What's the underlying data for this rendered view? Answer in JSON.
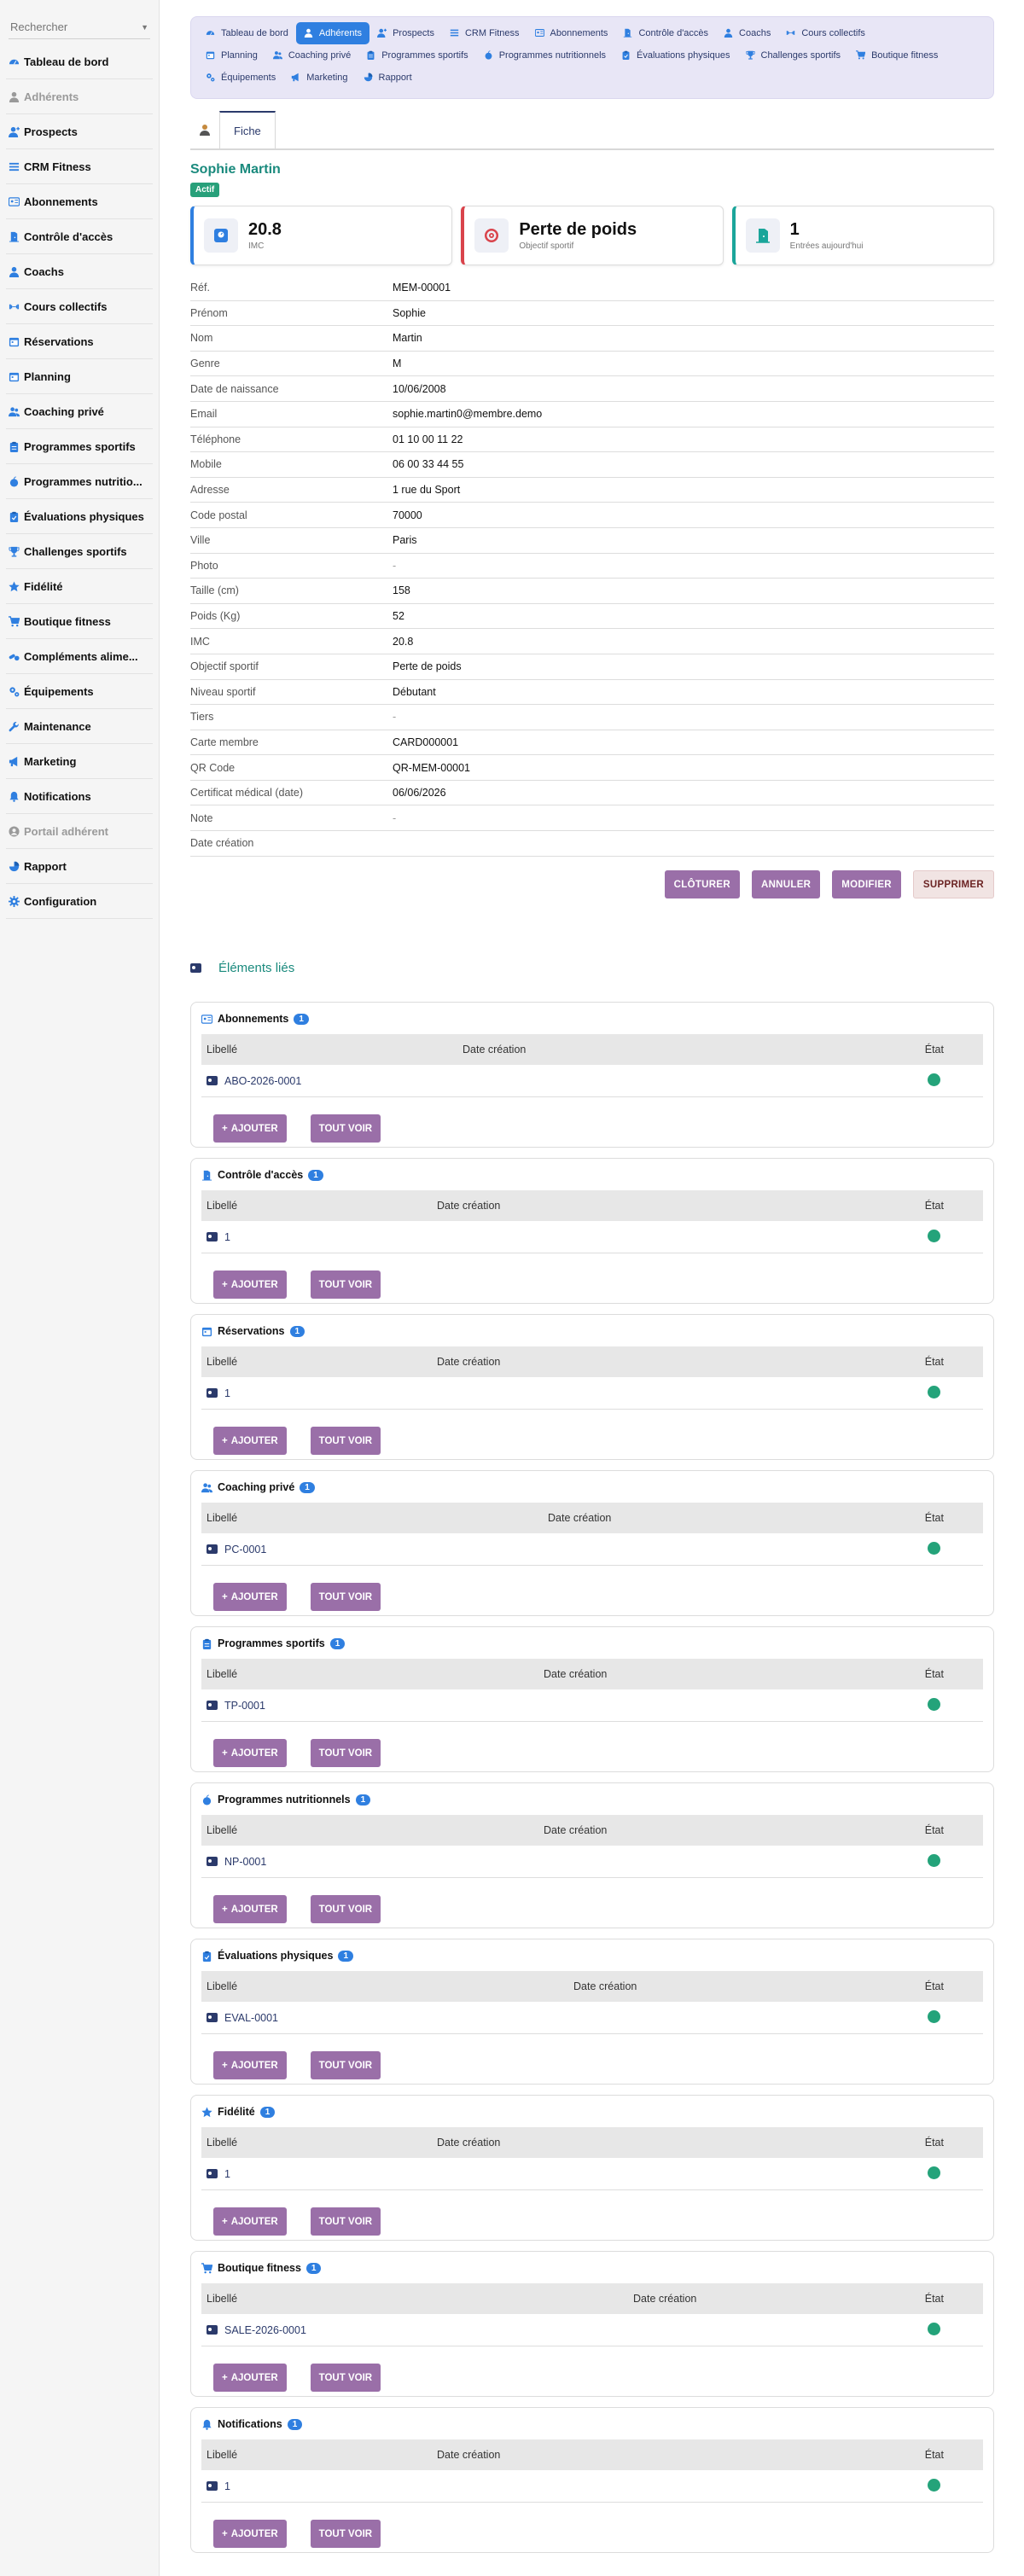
{
  "sidebar": {
    "search_placeholder": "Rechercher",
    "items": [
      {
        "label": "Tableau de bord",
        "icon": "dashboard-icon",
        "dim": false
      },
      {
        "label": "Adhérents",
        "icon": "user-icon",
        "dim": true
      },
      {
        "label": "Prospects",
        "icon": "user-plus-icon",
        "dim": false
      },
      {
        "label": "CRM Fitness",
        "icon": "list-icon",
        "dim": false
      },
      {
        "label": "Abonnements",
        "icon": "card-icon",
        "dim": false
      },
      {
        "label": "Contrôle d'accès",
        "icon": "door-icon",
        "dim": false
      },
      {
        "label": "Coachs",
        "icon": "user-icon",
        "dim": false
      },
      {
        "label": "Cours collectifs",
        "icon": "dumbbell-icon",
        "dim": false
      },
      {
        "label": "Réservations",
        "icon": "calendar-icon",
        "dim": false
      },
      {
        "label": "Planning",
        "icon": "calendar-icon",
        "dim": false
      },
      {
        "label": "Coaching privé",
        "icon": "users-icon",
        "dim": false
      },
      {
        "label": "Programmes sportifs",
        "icon": "clipboard-icon",
        "dim": false
      },
      {
        "label": "Programmes nutritio...",
        "icon": "apple-icon",
        "dim": false
      },
      {
        "label": "Évaluations physiques",
        "icon": "clipboard-check-icon",
        "dim": false
      },
      {
        "label": "Challenges sportifs",
        "icon": "trophy-icon",
        "dim": false
      },
      {
        "label": "Fidélité",
        "icon": "star-icon",
        "dim": false
      },
      {
        "label": "Boutique fitness",
        "icon": "cart-icon",
        "dim": false
      },
      {
        "label": "Compléments alime...",
        "icon": "capsule-icon",
        "dim": false
      },
      {
        "label": "Équipements",
        "icon": "gears-icon",
        "dim": false
      },
      {
        "label": "Maintenance",
        "icon": "wrench-icon",
        "dim": false
      },
      {
        "label": "Marketing",
        "icon": "megaphone-icon",
        "dim": false
      },
      {
        "label": "Notifications",
        "icon": "bell-icon",
        "dim": false
      },
      {
        "label": "Portail adhérent",
        "icon": "user-circle-icon",
        "dim": true
      },
      {
        "label": "Rapport",
        "icon": "pie-icon",
        "dim": false
      },
      {
        "label": "Configuration",
        "icon": "gear-icon",
        "dim": false
      }
    ]
  },
  "topnav": {
    "row1": [
      {
        "label": "Tableau de bord",
        "active": false
      },
      {
        "label": "Adhérents",
        "active": true
      },
      {
        "label": "Prospects",
        "active": false
      },
      {
        "label": "CRM Fitness",
        "active": false
      },
      {
        "label": "Abonnements",
        "active": false
      },
      {
        "label": "Contrôle d'accès",
        "active": false
      },
      {
        "label": "Coachs",
        "active": false
      },
      {
        "label": "Cours collectifs",
        "active": false
      }
    ],
    "row2": [
      {
        "label": "Planning"
      },
      {
        "label": "Coaching privé"
      },
      {
        "label": "Programmes sportifs"
      },
      {
        "label": "Programmes nutritionnels"
      },
      {
        "label": "Évaluations physiques"
      },
      {
        "label": "Challenges sportifs"
      },
      {
        "label": "Boutique fitness"
      }
    ],
    "row3": [
      {
        "label": "Équipements"
      },
      {
        "label": "Marketing"
      },
      {
        "label": "Rapport"
      }
    ]
  },
  "tab": {
    "label": "Fiche"
  },
  "member": {
    "name": "Sophie Martin",
    "status": "Actif"
  },
  "kpis": [
    {
      "value": "20.8",
      "label": "IMC",
      "accent": "#2f7fe0",
      "icon": "scale-icon"
    },
    {
      "value": "Perte de poids",
      "label": "Objectif sportif",
      "accent": "#d9434b",
      "icon": "target-icon"
    },
    {
      "value": "1",
      "label": "Entrées aujourd'hui",
      "accent": "#1aa59a",
      "icon": "door-icon"
    }
  ],
  "fields": [
    {
      "k": "Réf.",
      "v": "MEM-00001"
    },
    {
      "k": "Prénom",
      "v": "Sophie"
    },
    {
      "k": "Nom",
      "v": "Martin"
    },
    {
      "k": "Genre",
      "v": "M"
    },
    {
      "k": "Date de naissance",
      "v": "10/06/2008"
    },
    {
      "k": "Email",
      "v": "sophie.martin0@membre.demo"
    },
    {
      "k": "Téléphone",
      "v": "01 10 00 11 22"
    },
    {
      "k": "Mobile",
      "v": "06 00 33 44 55"
    },
    {
      "k": "Adresse",
      "v": "1 rue du Sport"
    },
    {
      "k": "Code postal",
      "v": "70000"
    },
    {
      "k": "Ville",
      "v": "Paris"
    },
    {
      "k": "Photo",
      "v": "-"
    },
    {
      "k": "Taille (cm)",
      "v": "158"
    },
    {
      "k": "Poids (Kg)",
      "v": "52"
    },
    {
      "k": "IMC",
      "v": "20.8"
    },
    {
      "k": "Objectif sportif",
      "v": "Perte de poids"
    },
    {
      "k": "Niveau sportif",
      "v": "Débutant"
    },
    {
      "k": "Tiers",
      "v": "-"
    },
    {
      "k": "Carte membre",
      "v": "CARD000001"
    },
    {
      "k": "QR Code",
      "v": "QR-MEM-00001"
    },
    {
      "k": "Certificat médical (date)",
      "v": "06/06/2026"
    },
    {
      "k": "Note",
      "v": "-"
    },
    {
      "k": "Date création",
      "v": ""
    }
  ],
  "actions": {
    "close": "CLÔTURER",
    "cancel": "ANNULER",
    "modify": "MODIFIER",
    "delete": "SUPPRIMER"
  },
  "linked_title": "Éléments liés",
  "col_headers": {
    "label": "Libellé",
    "date": "Date création",
    "state": "État"
  },
  "buttons": {
    "add": "AJOUTER",
    "see_all": "TOUT VOIR"
  },
  "sections": [
    {
      "title": "Abonnements",
      "count": "1",
      "ref": "ABO-2026-0001",
      "icon": "card-icon"
    },
    {
      "title": "Contrôle d'accès",
      "count": "1",
      "ref": "1",
      "icon": "door-icon"
    },
    {
      "title": "Réservations",
      "count": "1",
      "ref": "1",
      "icon": "calendar-icon"
    },
    {
      "title": "Coaching privé",
      "count": "1",
      "ref": "PC-0001",
      "icon": "users-icon"
    },
    {
      "title": "Programmes sportifs",
      "count": "1",
      "ref": "TP-0001",
      "icon": "clipboard-icon"
    },
    {
      "title": "Programmes nutritionnels",
      "count": "1",
      "ref": "NP-0001",
      "icon": "apple-icon"
    },
    {
      "title": "Évaluations physiques",
      "count": "1",
      "ref": "EVAL-0001",
      "icon": "clipboard-check-icon"
    },
    {
      "title": "Fidélité",
      "count": "1",
      "ref": "1",
      "icon": "star-icon"
    },
    {
      "title": "Boutique fitness",
      "count": "1",
      "ref": "SALE-2026-0001",
      "icon": "cart-icon"
    },
    {
      "title": "Notifications",
      "count": "1",
      "ref": "1",
      "icon": "bell-icon"
    }
  ],
  "colors": {
    "accent": "#2f7fe0",
    "primary_btn": "#9a6fa8",
    "teal": "#1a8a7d",
    "nav_text": "#2b3a6b",
    "status_green": "#24a37a"
  }
}
